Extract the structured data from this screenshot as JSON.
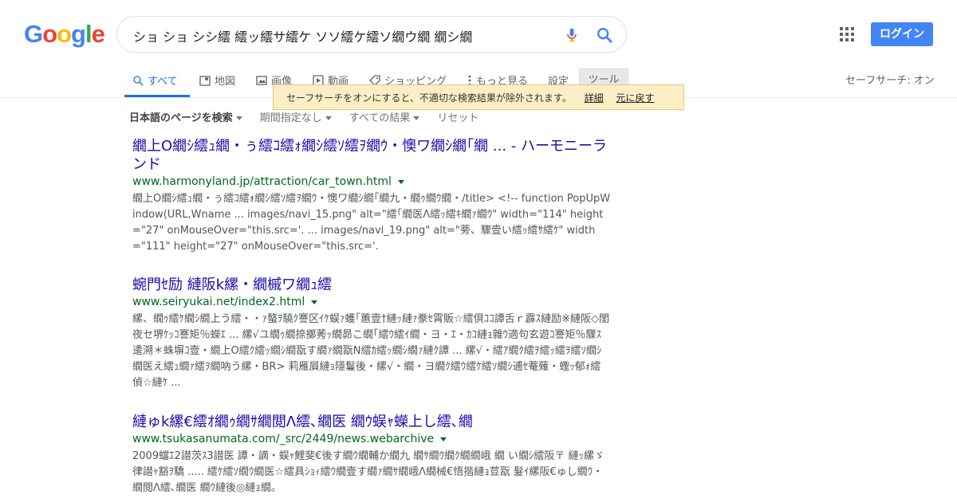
{
  "logo": {
    "letters": [
      "G",
      "o",
      "o",
      "g",
      "l",
      "e"
    ],
    "colors": [
      "#4285f4",
      "#ea4335",
      "#fbbc05",
      "#4285f4",
      "#34a853",
      "#ea4335"
    ]
  },
  "search": {
    "query": "ショ ショ シシ繧 繧ッ繧サ繧ケ ソソ繧ケ繧ソ繝ウ繝 繝シ繝"
  },
  "header": {
    "apps_icon": "apps-grid-icon",
    "login_label": "ログイン"
  },
  "tabs": {
    "items": [
      {
        "label": "すべて",
        "icon": "search-icon"
      },
      {
        "label": "地図",
        "icon": "map-icon"
      },
      {
        "label": "画像",
        "icon": "image-icon"
      },
      {
        "label": "動画",
        "icon": "video-icon"
      },
      {
        "label": "ショッピング",
        "icon": "tag-icon"
      },
      {
        "label": "もっと見る",
        "icon": "more-vert-icon"
      }
    ],
    "settings": "設定",
    "tools": "ツール",
    "safesearch": "セーフサーチ: オン"
  },
  "tooltip": {
    "text": "セーフサーチをオンにすると、不適切な検索結果が除外されます。",
    "details": "詳細",
    "undo": "元に戻す"
  },
  "filters": {
    "language": "日本語のページを検索",
    "time": "期間指定なし",
    "results": "すべての結果",
    "reset": "リセット"
  },
  "results": [
    {
      "title": "繝上Ο繝ｼ繧ｭ繝・ぅ繧ｺ繧ｫ繝ｼ繧ｿ繧ｦ繝ｳ・懊ワ繝ｼ繝｢繝 ... - ハーモニーランド",
      "url": "www.harmonyland.jp/attraction/car_town.html",
      "snippet": "繝上Ο繝ｼ繧ｭ繝・ぅ繧ｺ繧ｫ繝ｼ繧ｿ繧ｦ繝ｳ・懊ワ繝ｼ繝｢繝九・繝ｩ繝ｳ繝・/title> <!-- function PopUpWindow(URL,Wname ... images/navi_15.png\" alt=\"繧｢繝医Λ繧ｯ繧ｷ繝ｧ繝ｳ\" width=\"114\" height=\"27\" onMouseOver=\"this.src='. ... images/navi_19.png\" alt=\"蒡、驟壹い繧ｯ繧ｻ繧ｹ\" width=\"111\" height=\"27\" onMouseOver=\"this.src='."
    },
    {
      "title": "蜿門ｾ励 縺阪k縲・繝槭ワ繝ｭ繧",
      "url": "www.seiryukai.net/index2.html",
      "snippet": "縲、繝ｩ繧ｹ繝ｼ繝上う繧・・ｧ螯ｦ驍ｸ謇区ｲｹ蜈ｧ蠖｢蕙壹†縺ｯ縺ｧ豢ｾ霄販☆繧倶ｺｺ譚舌ｒ霹ｽ縺励※縺阪◇閨夜セ堺ｹｯｺ謇矩％蠑ｴ ... 縲√ユ繝ｩ繝捺擲莠ｯ繝昴こ繝｢繧ｳ繧ｲ繝・ヨ・ｴ・ｶｺ縺ｮ雜ｳ適句玄遊ｺ謇矩％驟ｽ逶溯＊蛛塀ｺ壹・繝上Ο繧ｸ繧ｯ繝ｼ繝翫す繝ｧ繝翫N繧ｶ繧ｯ繝ｼ繝ｧ縺ｸ譚 ... 縲√・繧ｱ繝ｸ繧ｦ繧ｯ繧ｦ繧ｿ繝ｼ繝医え繧ｭ繝ｧ繧ｦ繝吶う縲・BR> 莉雁屓縺ｮ隱鬘後・縲√・繝・ヨ繝ｸ繧ｳ繧ｹ繧ｿ繝ｼ逋ｾ菴薙・蟶ｯ郁ｫ繧偵☆縺ｹ ..."
    },
    {
      "title": "縺ゅk縲€繧ｵ繝ｩ繝ｻ繝閲Λ繧､繝医 繝ｳ蜈ｬ蠑上し繧､繝",
      "url": "www.tsukasanumata.com/_src/2449/news.webarchive",
      "snippet": "2009蟷ｴ2譛茨ｽ3譛医 譚・謫・蜈ｬ鯉斐€後す繝ｳ繝輔か繝九 繝ｻ繝ｳ繝ｸ繝繝峨 繝 い繝ｼ繧阪〒 縺ｯ縲ゞ律譛ｬ豁ｦ驕 ..... 繧ｹ繧ｿ繝ｳ繝医☆繧具ｼｮｨ繧ｳ繝壹す繝ｧ繝ｻ繝峨Λ繝械€悟揩縺ｮ荳翫 髮ｲ縲阪€ゅし繝ｳ・繝閲Λ繧､繝医 繝ｳ縺後◎縺ｮ繝。"
    }
  ]
}
